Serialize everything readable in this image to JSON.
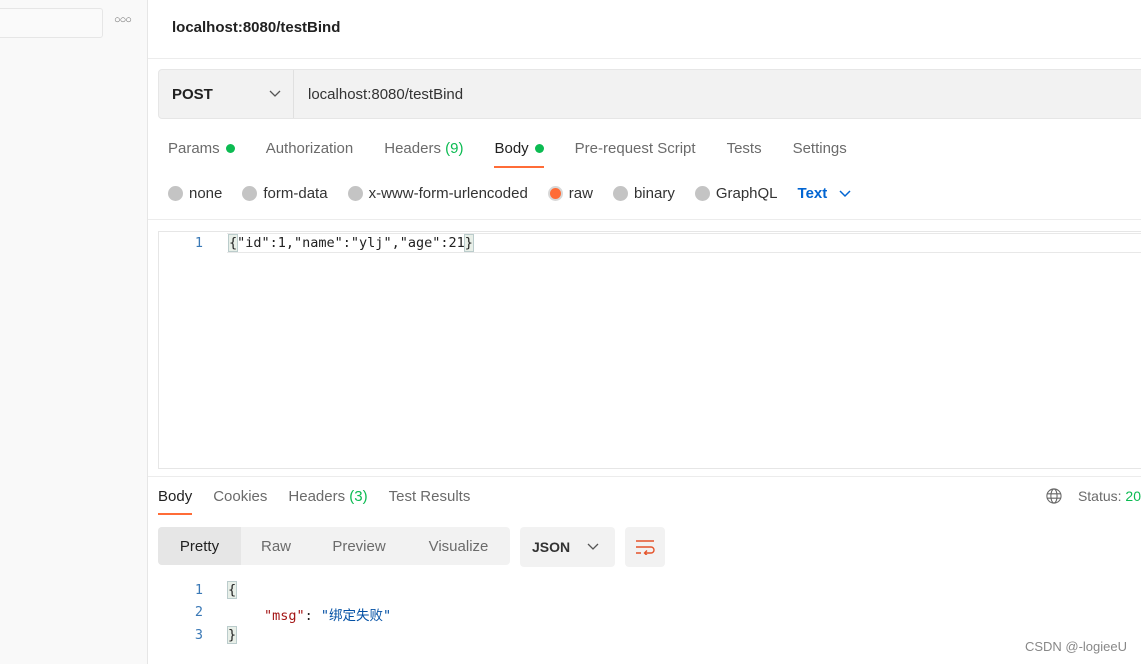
{
  "sidebar": {
    "more_icon": "more-horizontal-icon"
  },
  "request": {
    "title": "localhost:8080/testBind",
    "method": "POST",
    "url": "localhost:8080/testBind"
  },
  "req_tabs": [
    {
      "label": "Params",
      "dot": true
    },
    {
      "label": "Authorization"
    },
    {
      "label": "Headers",
      "count": "(9)"
    },
    {
      "label": "Body",
      "dot": true,
      "active": true
    },
    {
      "label": "Pre-request Script"
    },
    {
      "label": "Tests"
    },
    {
      "label": "Settings"
    }
  ],
  "body_types": [
    "none",
    "form-data",
    "x-www-form-urlencoded",
    "raw",
    "binary",
    "GraphQL"
  ],
  "body_selected": "raw",
  "raw_format": "Text",
  "request_body": {
    "line": "1",
    "code": "\"id\":1,\"name\":\"ylj\",\"age\":21",
    "open": "{",
    "close": "}"
  },
  "resp_tabs": [
    "Body",
    "Cookies",
    "Headers",
    "Test Results"
  ],
  "resp_headers_count": "(3)",
  "status": {
    "label": "Status:",
    "value": "20"
  },
  "view_modes": [
    "Pretty",
    "Raw",
    "Preview",
    "Visualize"
  ],
  "resp_format": "JSON",
  "response": {
    "lines": [
      "1",
      "2",
      "3"
    ],
    "open": "{",
    "key": "\"msg\"",
    "colon": ": ",
    "value": "\"绑定失败\"",
    "close": "}"
  },
  "watermark": "CSDN @-logieeU",
  "colors": {
    "accent": "#ff6c37",
    "green": "#0cbb52",
    "link": "#0265d2"
  }
}
